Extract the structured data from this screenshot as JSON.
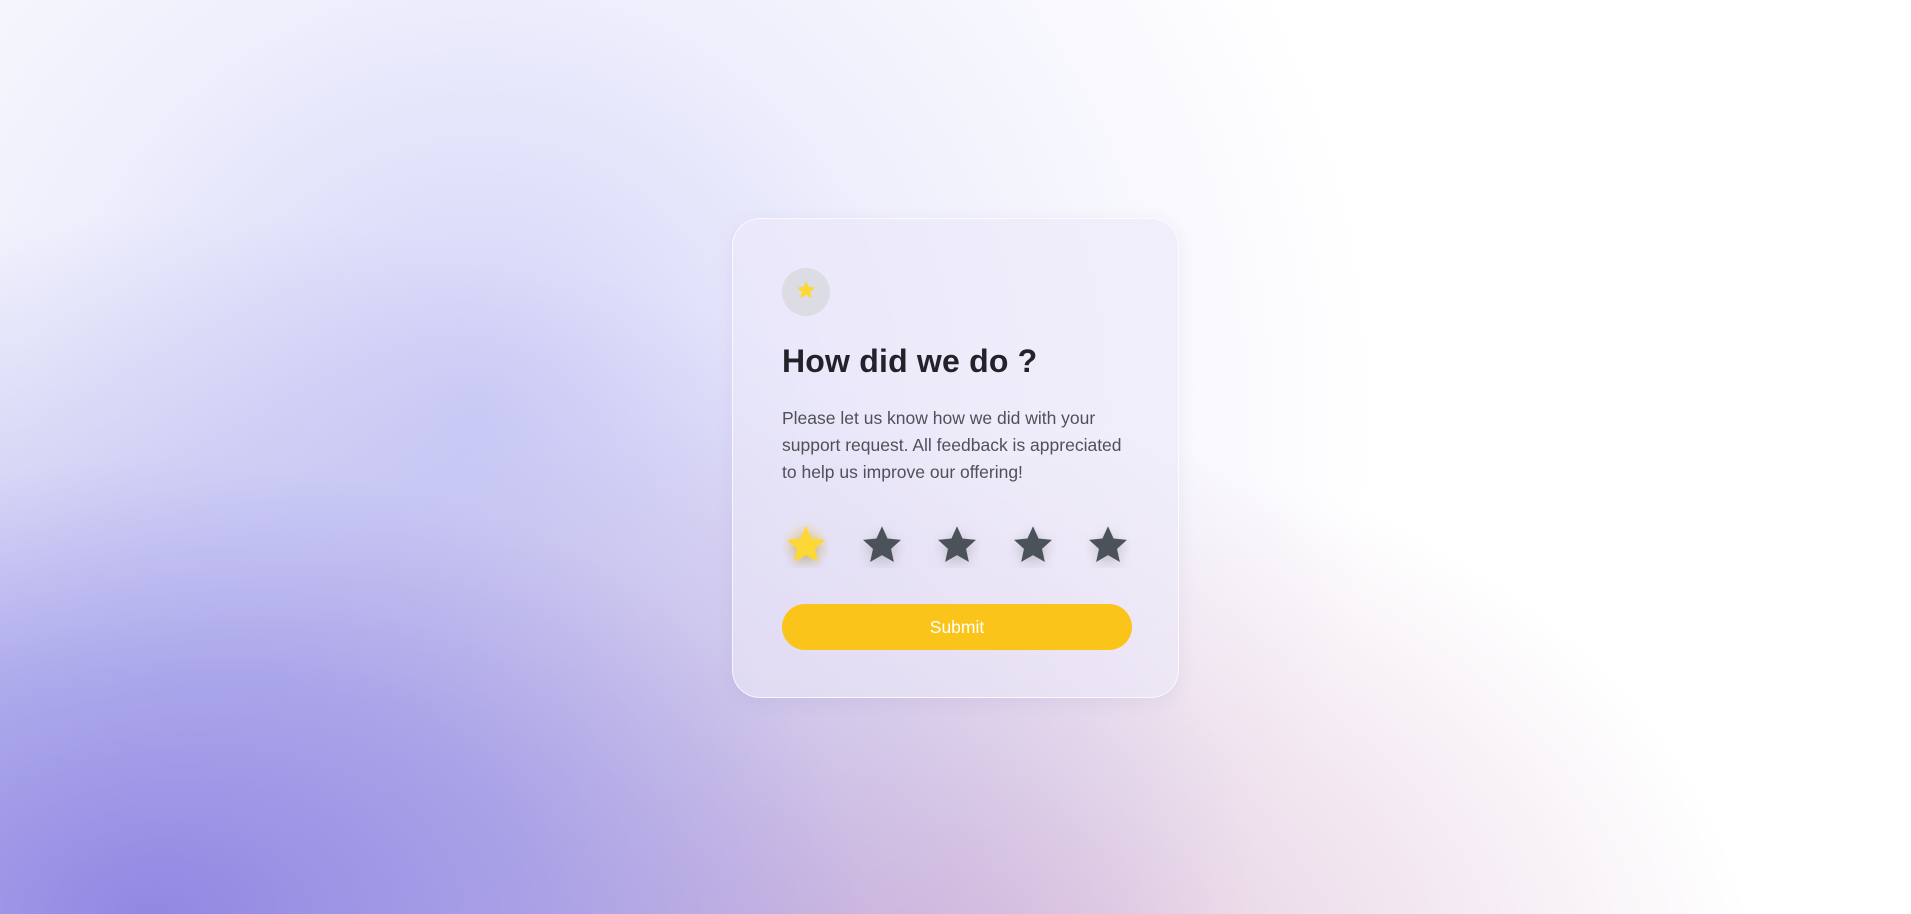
{
  "card": {
    "title": "How did we do ?",
    "description": "Please let us know how we did with your support request. All feedback is appreciated to help us improve our offering!",
    "badge_icon": "star-icon",
    "submit_label": "Submit"
  },
  "rating": {
    "max": 5,
    "selected": 1,
    "star_icon": "star-icon"
  },
  "colors": {
    "accent": "#fbc41a",
    "star_active": "#fdd835",
    "star_inactive": "#4b5259",
    "title": "#22232a",
    "body_text": "#4f5058"
  }
}
